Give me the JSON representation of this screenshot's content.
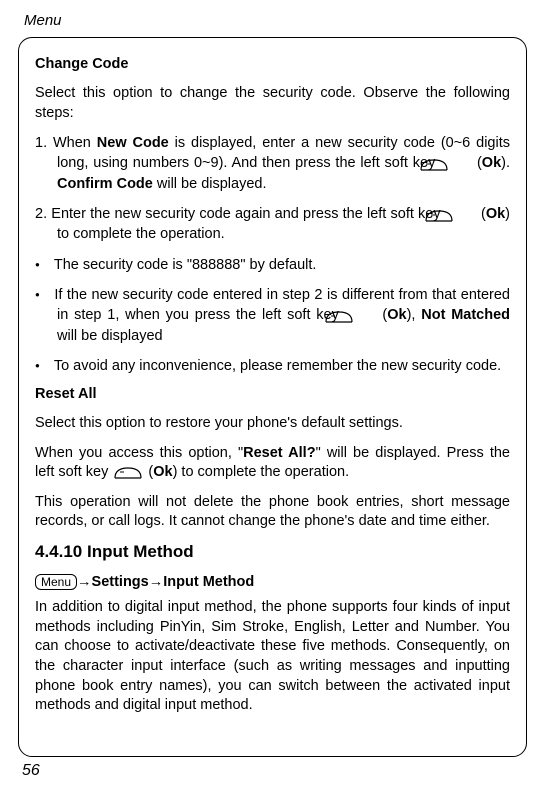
{
  "header": {
    "title": "Menu"
  },
  "changeCode": {
    "heading": "Change Code",
    "intro": "Select this option to change the security code. Observe the following steps:",
    "step1_a": "1.  When ",
    "step1_b": "New Code",
    "step1_c": " is displayed, enter a new security code (0~6 digits long, using numbers 0~9). And then press the left soft key ",
    "step1_d": " (",
    "step1_e": "Ok",
    "step1_f": "). ",
    "step1_g": "Confirm Code",
    "step1_h": " will be displayed.",
    "step2_a": "2.  Enter the new security code again and press the left soft key ",
    "step2_b": " (",
    "step2_c": "Ok",
    "step2_d": ") to complete the operation.",
    "bullet1": "The security code is \"888888\" by default.",
    "bullet2_a": "If the new security code entered in step 2 is different from that entered in step 1, when you press the left soft key ",
    "bullet2_b": " (",
    "bullet2_c": "Ok",
    "bullet2_d": "), ",
    "bullet2_e": "Not Matched",
    "bullet2_f": " will be displayed",
    "bullet3": "To avoid any inconvenience, please remember the new security code."
  },
  "resetAll": {
    "heading": "Reset All",
    "p1": "Select this option to restore your phone's default settings.",
    "p2_a": "When you access this option, \"",
    "p2_b": "Reset All?",
    "p2_c": "\" will be displayed. Press the left soft key ",
    "p2_d": " (",
    "p2_e": "Ok",
    "p2_f": ") to complete the operation.",
    "p3": "This operation will not delete the phone book entries, short message records, or call logs. It cannot change the phone's date and time either."
  },
  "inputMethod": {
    "heading": "4.4.10 Input Method",
    "menuLabel": "Menu",
    "arrow1": "→",
    "nav1": "Settings",
    "arrow2": "→",
    "nav2": "Input Method",
    "body": "In addition to digital input method, the phone supports four kinds of input methods including PinYin, Sim Stroke, English, Letter and Number. You can choose to activate/deactivate these five methods. Consequently, on the character input interface (such as writing messages and inputting phone book entry names), you can switch between the activated input methods and digital input method."
  },
  "pageNumber": "56"
}
